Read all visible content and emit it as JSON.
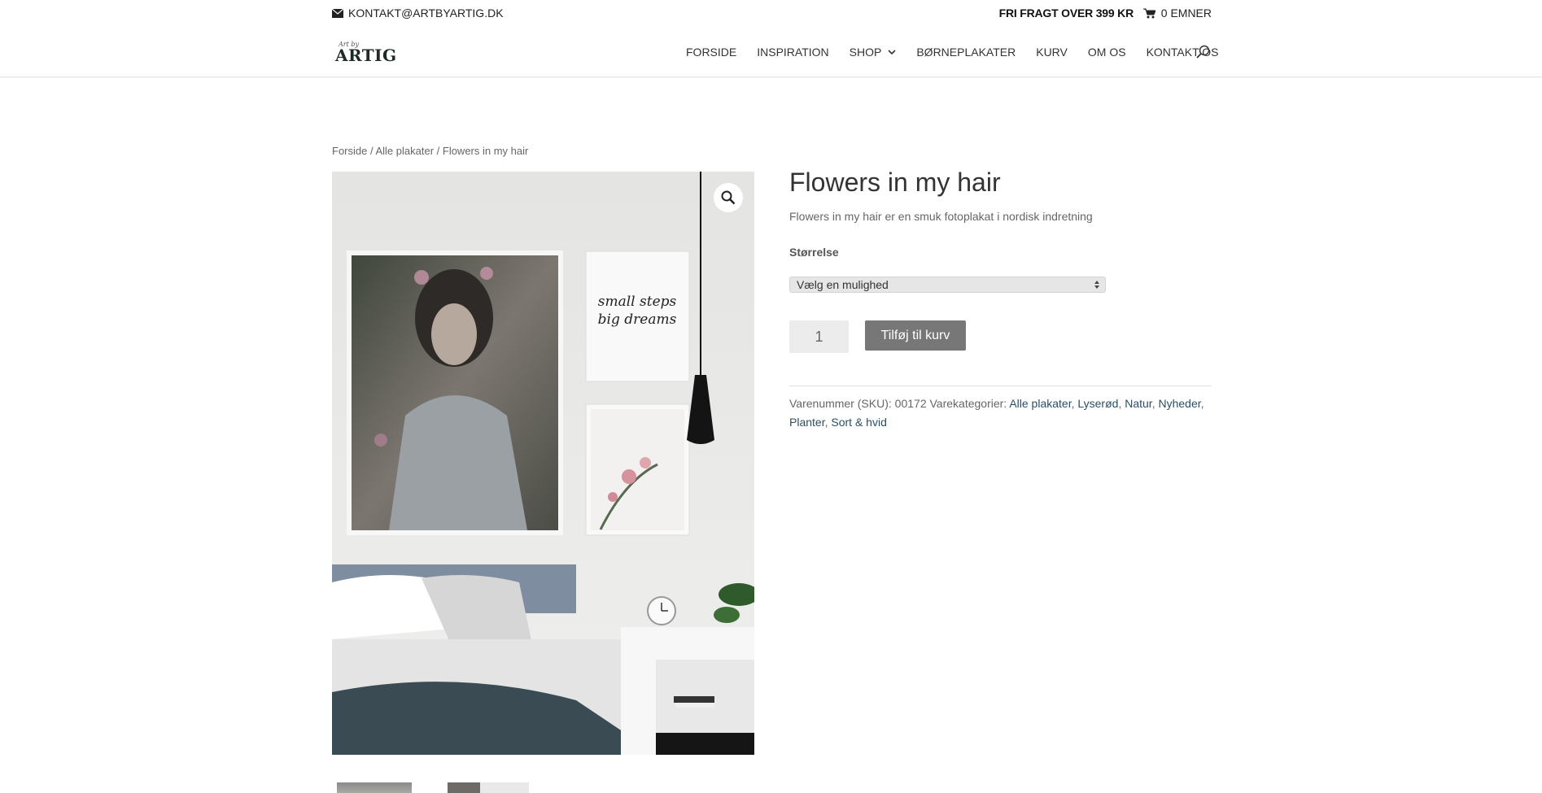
{
  "topbar": {
    "email": "KONTAKT@ARTBYARTIG.DK",
    "email_icon": "envelope-icon",
    "free_shipping": "FRI FRAGT OVER 399 KR",
    "cart_label": "0 EMNER",
    "cart_icon": "cart-icon"
  },
  "logo": {
    "small": "Art by",
    "main": "ARTIG"
  },
  "nav": {
    "items": [
      "FORSIDE",
      "INSPIRATION",
      "SHOP",
      "BØRNEPLAKATER",
      "KURV",
      "OM OS",
      "KONTAKT OS"
    ],
    "search_icon": "search-icon"
  },
  "breadcrumb": {
    "home": "Forside",
    "category": "Alle plakater",
    "current": "Flowers in my hair",
    "separator": " / "
  },
  "product": {
    "title": "Flowers in my hair",
    "description": "Flowers in my hair er en smuk fotoplakat i nordisk indretning",
    "size_label": "Størrelse",
    "size_select": "Vælg en mulighed",
    "quantity": "1",
    "add_to_cart": "Tilføj til kurv",
    "image_text": "small steps big dreams",
    "zoom_icon": "magnifier-icon",
    "sku_label": "Varenummer (SKU):",
    "sku": "00172",
    "categories_label": "Varekategorier:",
    "categories": [
      "Alle plakater",
      "Lyserød",
      "Natur",
      "Nyheder",
      "Planter",
      "Sort & hvid"
    ]
  },
  "colors": {
    "link": "#2b4f62",
    "button": "#777777",
    "title": "#333333"
  }
}
